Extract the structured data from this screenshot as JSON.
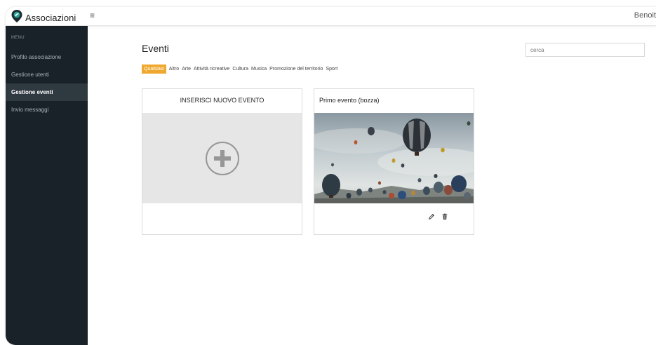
{
  "app": {
    "name": "Associazioni",
    "user_name": "Benoit"
  },
  "sidebar": {
    "header": "MENU",
    "items": [
      {
        "label": "Profilo associazione"
      },
      {
        "label": "Gestione utenti"
      },
      {
        "label": "Gestione eventi",
        "active": true
      },
      {
        "label": "Invio messaggi"
      }
    ]
  },
  "main": {
    "title": "Eventi",
    "search": {
      "placeholder": "cerca"
    },
    "filters": [
      "Qualsiasi",
      "Altro",
      "Arte",
      "Attività ricreative",
      "Cultura",
      "Musica",
      "Promozione del territorio",
      "Sport"
    ],
    "active_filter": "Qualsiasi",
    "new_event_card": {
      "title": "INSERISCI NUOVO EVENTO"
    },
    "event_cards": [
      {
        "title": "Primo evento (bozza)"
      }
    ]
  },
  "colors": {
    "sidebar_bg": "#182228",
    "accent": "#f0a930",
    "logo": "#1f7a8c"
  },
  "icons": [
    "map-pin-logo-icon",
    "hamburger-menu-icon",
    "plus-circle-icon",
    "edit-pencil-icon",
    "trash-icon"
  ]
}
